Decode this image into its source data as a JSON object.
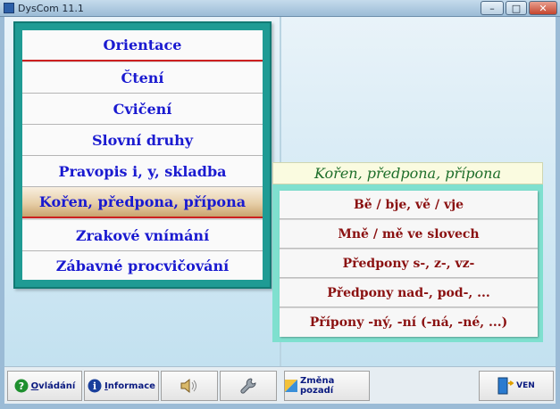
{
  "window": {
    "title": "DysCom 11.1"
  },
  "main_menu": {
    "items": [
      {
        "label": "Orientace"
      },
      {
        "label": "Čtení"
      },
      {
        "label": "Cvičení"
      },
      {
        "label": "Slovní druhy"
      },
      {
        "label": "Pravopis i, y, skladba"
      },
      {
        "label": "Kořen, předpona, přípona",
        "selected": true
      },
      {
        "label": "Zrakové vnímání"
      },
      {
        "label": "Zábavné procvičování"
      }
    ]
  },
  "submenu": {
    "title": "Kořen, předpona, přípona",
    "items": [
      {
        "label": "Bě / bje,  vě / vje"
      },
      {
        "label": "Mně / mě ve slovech"
      },
      {
        "label": "Předpony  s-, z-, vz-"
      },
      {
        "label": "Předpony nad-, pod-, ..."
      },
      {
        "label": "Přípony -ný, -ní (-ná, -né, ...)"
      }
    ]
  },
  "toolbar": {
    "controls_label": "Ovládání",
    "info_label": "Informace",
    "change_bg_label": "Změna pozadí",
    "exit_label": "VEN"
  },
  "colors": {
    "menu_frame": "#1f9b94",
    "menu_text": "#1a1ad0",
    "submenu_text": "#8a1010",
    "submenu_title": "#1e6e2a",
    "submenu_frame": "#7fe0cf"
  }
}
